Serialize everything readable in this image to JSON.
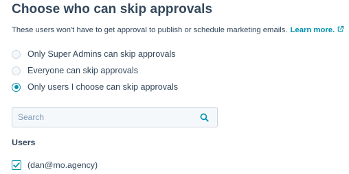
{
  "section": {
    "title": "Choose who can skip approvals",
    "description": "These users won't have to get approval to publish or schedule marketing emails.",
    "learn_more": "Learn more."
  },
  "options": [
    {
      "label": "Only Super Admins can skip approvals",
      "checked": false
    },
    {
      "label": "Everyone can skip approvals",
      "checked": false
    },
    {
      "label": "Only users I choose can skip approvals",
      "checked": true
    }
  ],
  "search": {
    "placeholder": "Search",
    "value": "",
    "icon": "search-icon"
  },
  "users": {
    "heading": "Users",
    "items": [
      {
        "label": "(dan@mo.agency)",
        "checked": true
      }
    ]
  },
  "colors": {
    "text": "#33475b",
    "accent": "#0091ae",
    "border": "#cbd6e2",
    "input_bg": "#f5f8fa",
    "placeholder": "#7c98b6"
  }
}
